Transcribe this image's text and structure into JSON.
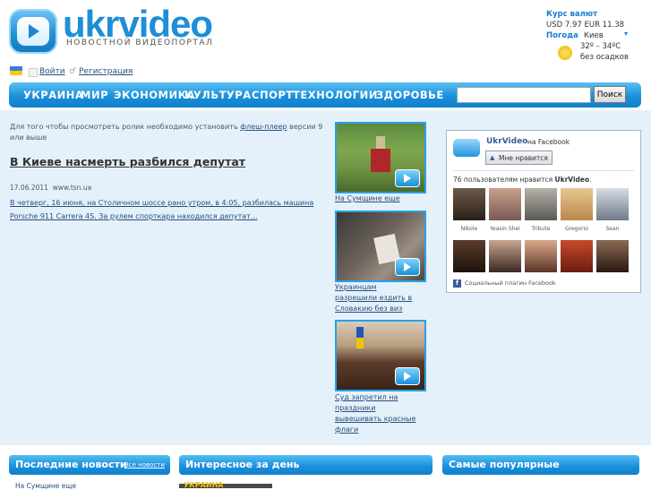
{
  "header": {
    "logo_text": "ukrvideo",
    "logo_subtitle": "НОВОСТНОЙ ВИДЕОПОРТАЛ",
    "currency_title": "Курс валют",
    "currency_usd": "USD 7.97",
    "currency_eur": "EUR 11.38",
    "weather_title": "Погода",
    "weather_city": "Киев",
    "weather_temp": "32º – 34ºC",
    "weather_desc": "без осадков"
  },
  "account": {
    "login_label": "Войти",
    "register_label": "Регистрация"
  },
  "nav": {
    "items": [
      "УКРАИНА",
      "МИР",
      "ЭКОНОМИКА",
      "КУЛЬТУРА",
      "СПОРТ",
      "ТЕХНОЛОГИИ",
      "ЗДОРОВЬЕ"
    ],
    "search_button": "Поиск",
    "search_value": ""
  },
  "main": {
    "flash_notice_prefix": "Для того чтобы просмотреть ролик необходимо установить ",
    "flash_notice_link": "флеш-плеер",
    "flash_notice_suffix": " версии 9 или выше",
    "headline": "В Киеве насмерть разбился депутат",
    "date": "17.06.2011",
    "source": "www.tsn.ua",
    "summary": "В четверг, 16 июня, на Столичном шоссе рано утром, в 4:05, разбилась машина Porsche 911 Carrera 4S. За рулем спорткара находился депутат..."
  },
  "side_videos": [
    {
      "caption": "На Сумщине еще"
    },
    {
      "caption": "Украинцам разрешили ездить в Словакию без виз"
    },
    {
      "caption": "Суд запретил на праздники вывешивать красные флаги"
    }
  ],
  "facebook": {
    "page_name": "UkrVideo",
    "on_facebook": "на Facebook",
    "like_button": "Мне нравится",
    "likes_text_prefix": "76 пользователям нравится ",
    "likes_text_page": "UkrVideo",
    "likes_text_suffix": ".",
    "fans": [
      "Nikole",
      "Yeasin Shei",
      "Tribute",
      "Gregorio",
      "Sean"
    ],
    "plugin_text": "Социальный плагин Facebook"
  },
  "sections": {
    "latest_title": "Последние новости",
    "latest_link": "Все новости",
    "latest_first": "На Сумщине еще",
    "interesting_title": "Интересное за день",
    "interesting_thumb_label": "УКРАИНА",
    "popular_title": "Самые популярные"
  },
  "colors": {
    "accent": "#1a8fdb",
    "panel_bg": "#e4f1fb",
    "link": "#2a4f7c"
  }
}
